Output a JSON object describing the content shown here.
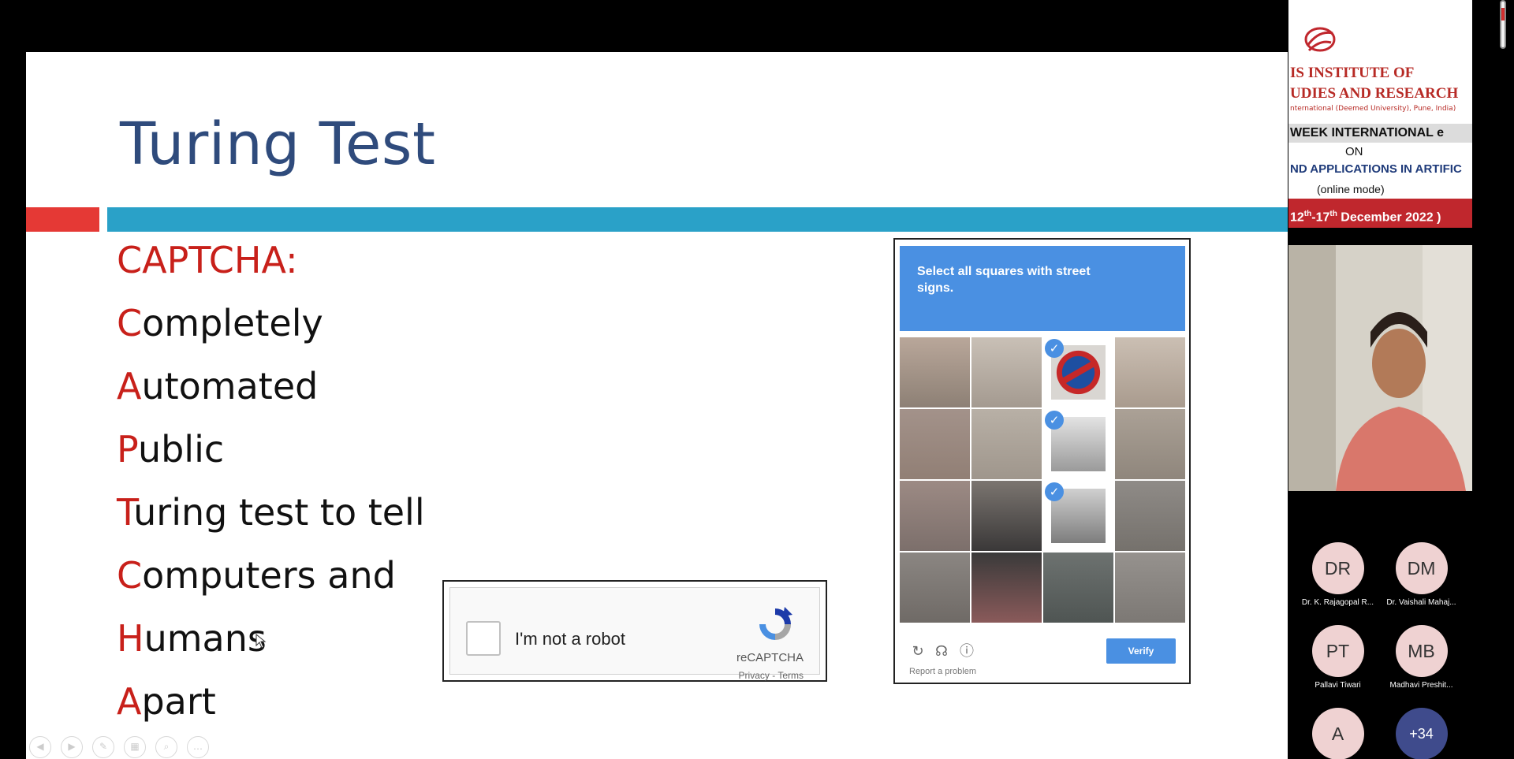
{
  "slide": {
    "title": "Turing Test",
    "captcha_heading": "CAPTCHA:",
    "lines": [
      {
        "first": "C",
        "rest": "ompletely"
      },
      {
        "first": "A",
        "rest": "utomated"
      },
      {
        "first": "P",
        "rest": "ublic"
      },
      {
        "first": "T",
        "rest": "uring test to tell"
      },
      {
        "first": "C",
        "rest": "omputers and"
      },
      {
        "first": "H",
        "rest": "umans"
      },
      {
        "first": "A",
        "rest": "part"
      }
    ],
    "colors": {
      "title": "#2f4b7c",
      "accent_red": "#e53935",
      "accent_blue": "#2aa1c8",
      "first_letter": "#c8201a"
    }
  },
  "recaptcha_checkbox": {
    "label": "I'm not a robot",
    "brand": "reCAPTCHA",
    "links": "Privacy - Terms"
  },
  "recaptcha_challenge": {
    "prompt": "Select all squares with street signs.",
    "selected_tiles": [
      2,
      6,
      10
    ],
    "verify_label": "Verify",
    "report_label": "Report a problem",
    "icons": [
      "reload-icon",
      "headphones-icon",
      "info-icon"
    ]
  },
  "banner": {
    "line1": "IS INSTITUTE OF",
    "line2": "UDIES AND RESEARCH",
    "line3": "nternational (Deemed University), Pune, India)",
    "line4": "WEEK INTERNATIONAL e",
    "line5": "ON",
    "line6": "ND APPLICATIONS IN ARTIFIC",
    "line7": "(online mode)",
    "date_a": "12",
    "date_sup_a": "th",
    "date_b": "-17",
    "date_sup_b": "th",
    "date_c": " December 2022 )"
  },
  "participants": [
    {
      "initials": "DR",
      "name": "Dr. K. Rajagopal R..."
    },
    {
      "initials": "DM",
      "name": "Dr. Vaishali Mahaj..."
    },
    {
      "initials": "PT",
      "name": "Pallavi Tiwari"
    },
    {
      "initials": "MB",
      "name": "Madhavi Preshit..."
    },
    {
      "initials": "A",
      "name": ""
    },
    {
      "initials": "+34",
      "name": ""
    }
  ]
}
